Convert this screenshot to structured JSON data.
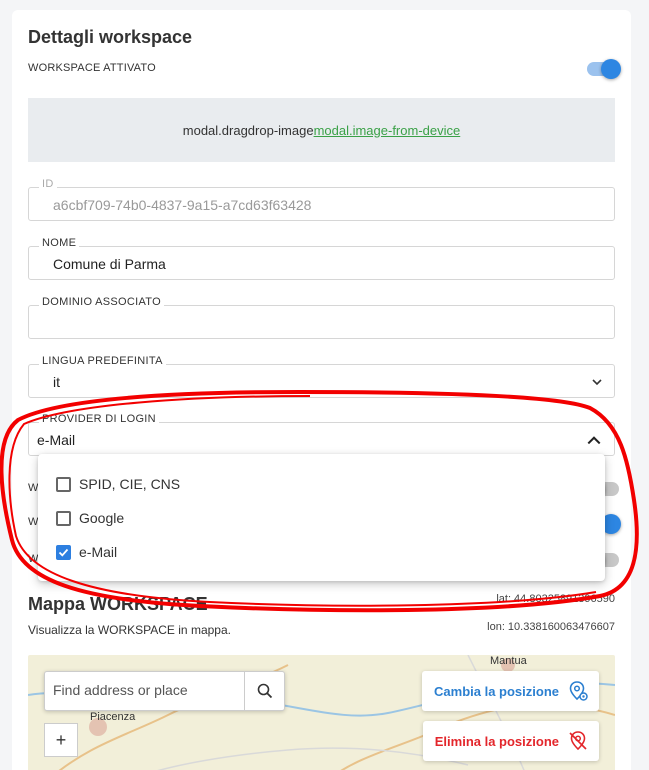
{
  "card": {
    "title": "Dettagli workspace",
    "toggle_label": "WORKSPACE ATTIVATO",
    "toggle_on": true
  },
  "dropzone": {
    "text": "modal.dragdrop-image",
    "link": "modal.image-from-device"
  },
  "fields": {
    "id": {
      "label": "ID",
      "value": "a6cbf709-74b0-4837-9a15-a7cd63f63428"
    },
    "nome": {
      "label": "NOME",
      "value": "Comune di Parma"
    },
    "dominio": {
      "label": "DOMINIO ASSOCIATO",
      "value": ""
    },
    "lingua": {
      "label": "LINGUA PREDEFINITA",
      "value": "it"
    },
    "provider": {
      "label": "PROVIDER DI LOGIN",
      "value": "e-Mail"
    }
  },
  "partial_rows": [
    {
      "label": "W",
      "toggle_on": false
    },
    {
      "label": "W",
      "toggle_on": true
    },
    {
      "label": "W",
      "toggle_on": false
    }
  ],
  "provider_options": [
    {
      "label": "SPID, CIE, CNS",
      "checked": false
    },
    {
      "label": "Google",
      "checked": false
    },
    {
      "label": "e-Mail",
      "checked": true
    }
  ],
  "map": {
    "title": "Mappa WORKSPACE",
    "subtitle": "Visualizza la WORKSPACE in mappa.",
    "lat": "lat: 44.80325891396590",
    "lon": "lon: 10.338160063476607",
    "search_placeholder": "Find address or place",
    "zoom_in": "+",
    "change_button": "Cambia la posizione",
    "delete_button": "Elimina la posizione",
    "place_labels": [
      "Piacenza",
      "Mantua"
    ]
  },
  "colors": {
    "accent": "#2d86e2",
    "link_green": "#3aa147",
    "change_button": "#2b7fd0",
    "delete_button": "#e3262b",
    "annotation_red": "#f20000"
  }
}
